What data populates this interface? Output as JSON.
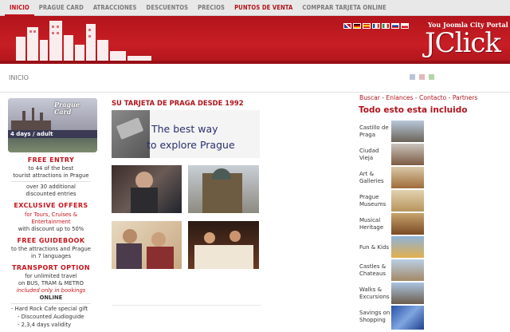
{
  "nav": {
    "items": [
      {
        "label": "INICIO",
        "active": true
      },
      {
        "label": "PRAGUE CARD",
        "active": false
      },
      {
        "label": "ATRACCIONES",
        "active": false
      },
      {
        "label": "DESCUENTOS",
        "active": false
      },
      {
        "label": "PRECIOS",
        "active": false
      },
      {
        "label": "PUNTOS DE VENTA",
        "active": false,
        "highlight": true
      },
      {
        "label": "COMPRAR TARJETA ONLINE",
        "active": false
      }
    ]
  },
  "banner": {
    "portal_text": "You Joomla City Portal",
    "logo_text": "JClick",
    "flags": [
      "uk",
      "de",
      "es",
      "fr",
      "it",
      "ru",
      "cz"
    ]
  },
  "breadcrumb": {
    "label": "INICIO"
  },
  "card": {
    "title_line1": "Prague",
    "title_line2": "Card",
    "days_text": "4 days / adult"
  },
  "left": {
    "free_entry_title": "FREE ENTRY",
    "free_entry_l1": "to 44 of the best",
    "free_entry_l2": "tourist attractions in Prague",
    "free_entry_l3": "over 30 additional",
    "free_entry_l4": "discounted entries",
    "exclusive_title": "EXCLUSIVE OFFERS",
    "exclusive_l1": "for Tours, Cruises &",
    "exclusive_l2": "Entertainment",
    "exclusive_l3": "with discount up to 50%",
    "guidebook_title": "FREE GUIDEBOOK",
    "guidebook_l1": "to the attractions and Prague",
    "guidebook_l2": "in 7 languages",
    "transport_title": "TRANSPORT OPTION",
    "transport_l1": "for unlimited travel",
    "transport_l2": "on BUS, TRAM & METRO",
    "transport_l3": "included only in bookings",
    "transport_l4": "ONLINE",
    "extra_l1": "- Hard Rock Cafe special gift",
    "extra_l2": "- Discounted Audioguide",
    "extra_l3": "- 2,3,4 days validity"
  },
  "center": {
    "title": "SU TARJETA DE PRAGA DESDE 1992",
    "hero_l1": "The best way",
    "hero_l2": "to explore Prague"
  },
  "right": {
    "links": "Buscar - Enlances - Contacto - Partners",
    "title": "Todo esto esta incluido",
    "items": [
      {
        "l1": "Castillo de",
        "l2": "Praga"
      },
      {
        "l1": "Ciudad",
        "l2": "Vieja"
      },
      {
        "l1": "Art &",
        "l2": "Galleries"
      },
      {
        "l1": "Prague",
        "l2": "Museums"
      },
      {
        "l1": "Musical",
        "l2": "Heritage"
      },
      {
        "l1": "Fun & Kids",
        "l2": ""
      },
      {
        "l1": "Castles &",
        "l2": "Chateaus"
      },
      {
        "l1": "Walks &",
        "l2": "Excursions"
      },
      {
        "l1": "Savings on",
        "l2": "Shopping"
      }
    ]
  },
  "colors": {
    "brand_red": "#c0121d",
    "nav_bg": "#e8e8e8",
    "hero_text": "#2a2f6e"
  }
}
